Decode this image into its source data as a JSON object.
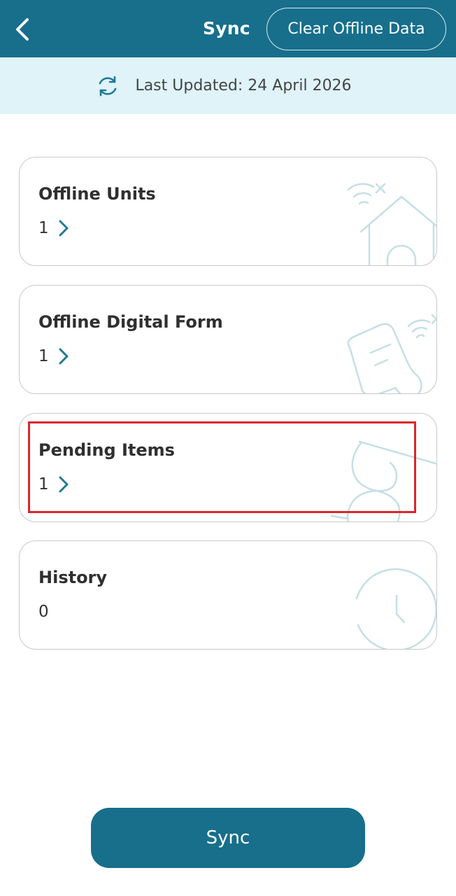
{
  "header": {
    "title": "Sync",
    "clear_label": "Clear Offline Data"
  },
  "banner": {
    "text": "Last Updated: 24 April 2026"
  },
  "cards": [
    {
      "title": "Offline Units",
      "count": "1",
      "has_chevron": true,
      "illustration": "offline-house-icon"
    },
    {
      "title": "Offline Digital Form",
      "count": "1",
      "has_chevron": true,
      "illustration": "offline-form-icon"
    },
    {
      "title": "Pending Items",
      "count": "1",
      "has_chevron": true,
      "illustration": "hourglass-icon",
      "highlighted": true
    },
    {
      "title": "History",
      "count": "0",
      "has_chevron": false,
      "illustration": "clock-icon"
    }
  ],
  "footer": {
    "sync_label": "Sync"
  },
  "colors": {
    "primary": "#176f8c",
    "banner_bg": "#dff3f9",
    "highlight": "#d9262e",
    "illustration_stroke": "#c5dfe6"
  }
}
